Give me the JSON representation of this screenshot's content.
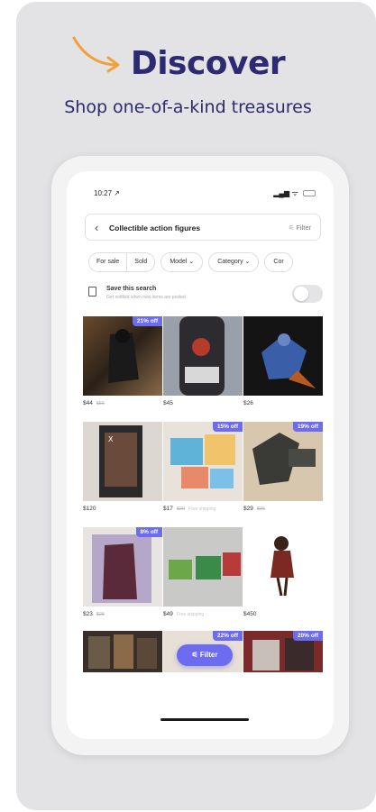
{
  "promo": {
    "headline": "Discover",
    "tagline": "Shop one-of-a-kind treasures",
    "brand_color": "#2c2a70",
    "accent_color": "#f0a13a"
  },
  "status_bar": {
    "time": "10:27 ↗",
    "signal": "▂▄▆",
    "wifi": "ᯤ"
  },
  "search": {
    "back_icon": "chevron-left-icon",
    "title": "Collectible action figures",
    "filter_label": "Filter",
    "filter_icon": "sliders-icon"
  },
  "chips": {
    "for_sale": "For sale",
    "sold": "Sold",
    "model": "Model ⌄",
    "category": "Category ⌄",
    "condition": "Cor"
  },
  "save_search": {
    "title": "Save this search",
    "subtitle": "Get notified when new items are posted",
    "enabled": false
  },
  "listings": [
    {
      "badge": "21% off",
      "price": "$44",
      "original": "$56",
      "shipping": ""
    },
    {
      "badge": "",
      "price": "$45",
      "original": "",
      "shipping": ""
    },
    {
      "badge": "",
      "price": "$26",
      "original": "",
      "shipping": ""
    },
    {
      "badge": "",
      "price": "$120",
      "original": "",
      "shipping": ""
    },
    {
      "badge": "15% off",
      "price": "$17",
      "original": "$20",
      "shipping": "Free shipping"
    },
    {
      "badge": "19% off",
      "price": "$29",
      "original": "$36",
      "shipping": ""
    },
    {
      "badge": "8% off",
      "price": "$23",
      "original": "$25",
      "shipping": ""
    },
    {
      "badge": "",
      "price": "$49",
      "original": "",
      "shipping": "Free shipping"
    },
    {
      "badge": "",
      "price": "$450",
      "original": "",
      "shipping": ""
    },
    {
      "badge": "",
      "price": "",
      "original": "",
      "shipping": ""
    },
    {
      "badge": "22% off",
      "price": "",
      "original": "",
      "shipping": ""
    },
    {
      "badge": "20% off",
      "price": "",
      "original": "",
      "shipping": ""
    }
  ],
  "floating_filter": {
    "label": "Filter",
    "color": "#6d6cf0"
  }
}
